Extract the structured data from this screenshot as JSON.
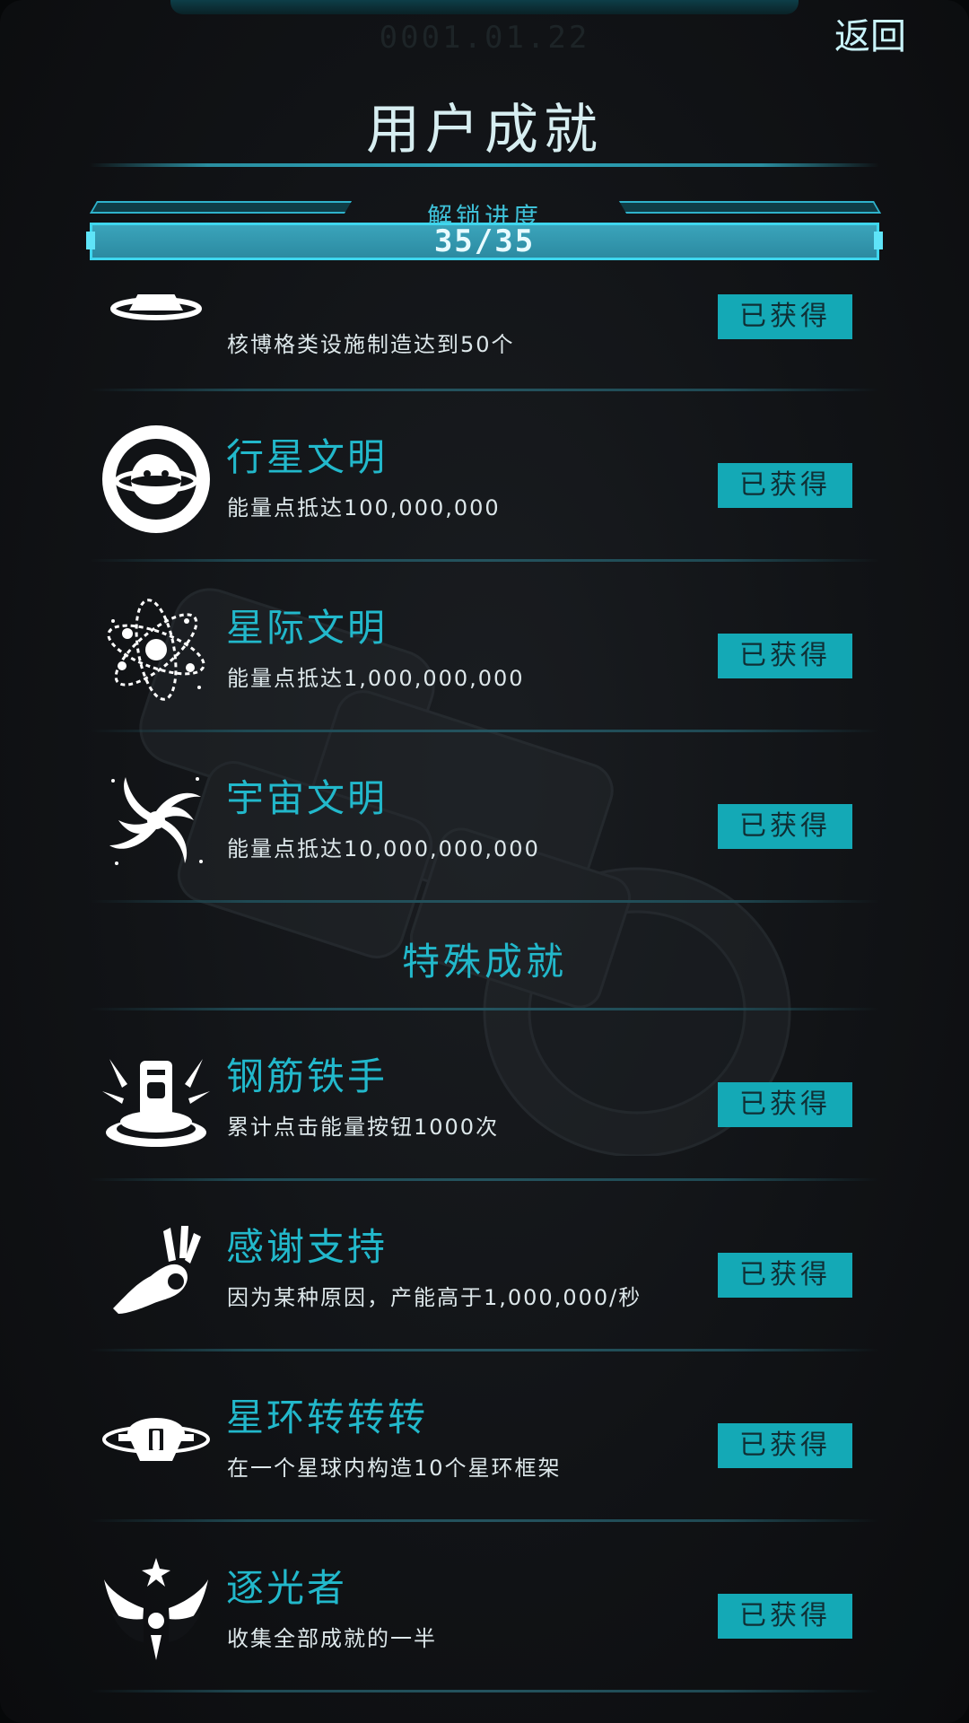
{
  "header": {
    "date": "0001.01.22",
    "back_label": "返回",
    "title": "用户成就"
  },
  "progress": {
    "label": "解锁进度",
    "text": "35/35",
    "unlocked": 35,
    "total": 35
  },
  "achievements": [
    {
      "icon": "mushroom-cloud-icon",
      "name": "",
      "desc": "核博格类设施制造达到50个",
      "status": "已获得"
    },
    {
      "icon": "planet-ring-icon",
      "name": "行星文明",
      "desc": "能量点抵达100,000,000",
      "status": "已获得"
    },
    {
      "icon": "atom-orbit-icon",
      "name": "星际文明",
      "desc": "能量点抵达1,000,000,000",
      "status": "已获得"
    },
    {
      "icon": "galaxy-spiral-icon",
      "name": "宇宙文明",
      "desc": "能量点抵达10,000,000,000",
      "status": "已获得"
    }
  ],
  "special_section": {
    "title": "特殊成就"
  },
  "special_achievements": [
    {
      "icon": "press-button-icon",
      "name": "钢筋铁手",
      "desc": "累计点击能量按钮1000次",
      "status": "已获得"
    },
    {
      "icon": "ok-hand-icon",
      "name": "感谢支持",
      "desc": "因为某种原因，产能高于1,000,000/秒",
      "status": "已获得"
    },
    {
      "icon": "ring-station-icon",
      "name": "星环转转转",
      "desc": "在一个星球内构造10个星环框架",
      "status": "已获得"
    },
    {
      "icon": "winged-star-icon",
      "name": "逐光者",
      "desc": "收集全部成就的一半",
      "status": "已获得"
    }
  ],
  "colors": {
    "accent": "#22b8cb",
    "status_bg": "#14a9b6",
    "background": "#111316"
  }
}
